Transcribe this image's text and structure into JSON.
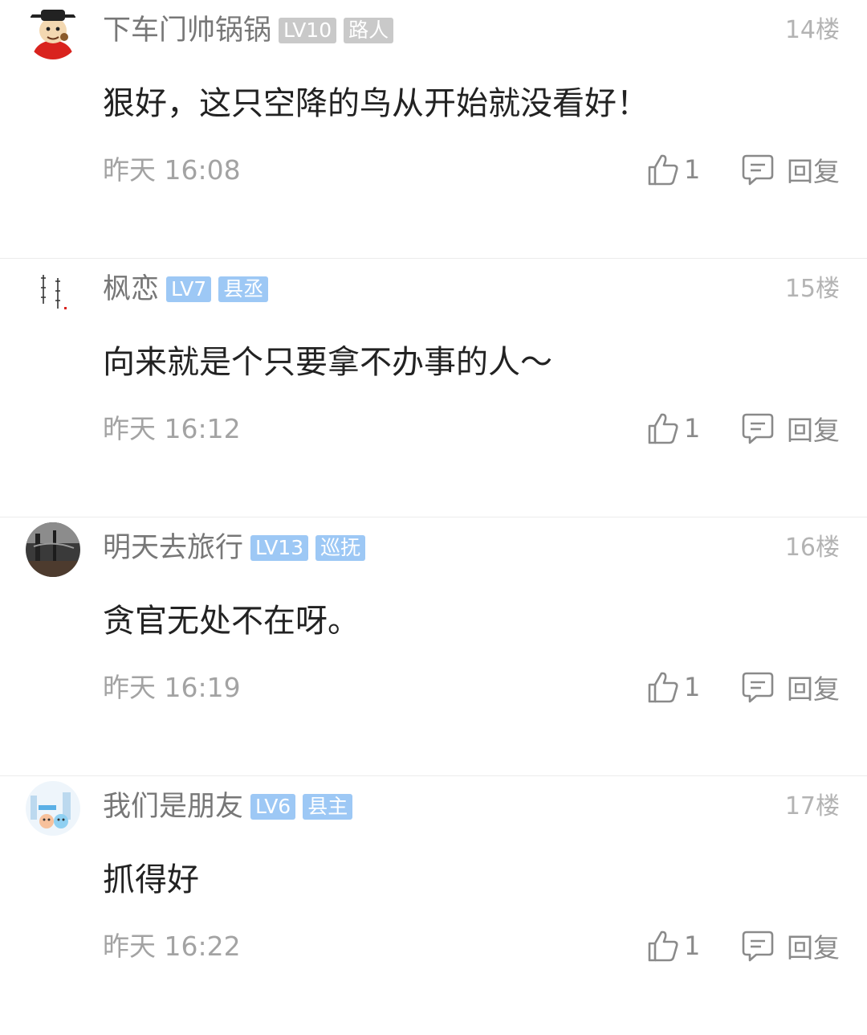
{
  "colors": {
    "level_badge_gray": "#c9c9c9",
    "level_badge_blue": "#9dc8f5",
    "username": "#777777",
    "content_text": "#222222",
    "meta_text": "#a3a3a3"
  },
  "icons": {
    "like": "thumbs-up-icon",
    "reply": "speech-bubble-icon"
  },
  "comments": [
    {
      "username": "下车门帅锅锅",
      "level": "LV10",
      "rank": "路人",
      "badge_style": "gray",
      "floor": "14楼",
      "content": "狠好，这只空降的鸟从开始就没看好！",
      "time": "昨天 16:08",
      "likes": "1",
      "reply_label": "回复"
    },
    {
      "username": "枫恋",
      "level": "LV7",
      "rank": "县丞",
      "badge_style": "blue",
      "floor": "15楼",
      "content": "向来就是个只要拿不办事的人～",
      "time": "昨天 16:12",
      "likes": "1",
      "reply_label": "回复"
    },
    {
      "username": "明天去旅行",
      "level": "LV13",
      "rank": "巡抚",
      "badge_style": "blue",
      "floor": "16楼",
      "content": "贪官无处不在呀。",
      "time": "昨天 16:19",
      "likes": "1",
      "reply_label": "回复"
    },
    {
      "username": "我们是朋友",
      "level": "LV6",
      "rank": "县主",
      "badge_style": "blue",
      "floor": "17楼",
      "content": "抓得好",
      "time": "昨天 16:22",
      "likes": "1",
      "reply_label": "回复"
    }
  ]
}
